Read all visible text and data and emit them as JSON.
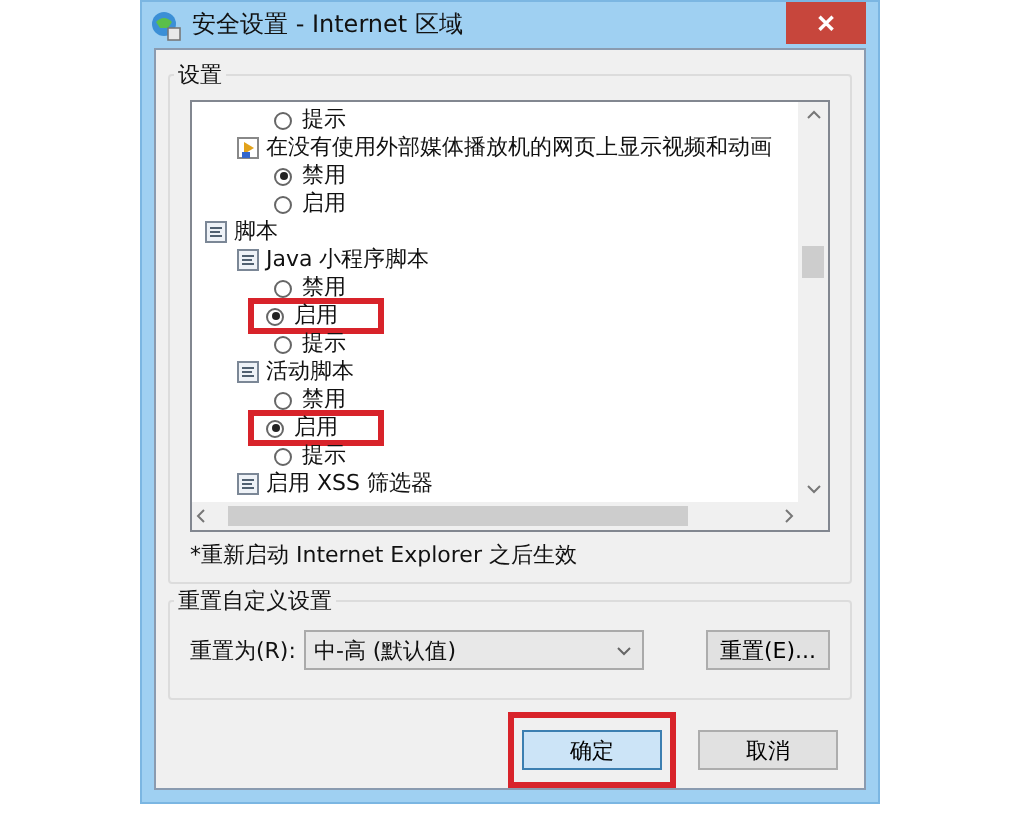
{
  "window": {
    "title": "安全设置 - Internet 区域",
    "close": "✕"
  },
  "settings": {
    "title": "设置",
    "items": [
      {
        "kind": "radio",
        "label": "提示",
        "selected": false,
        "highlighted": false
      },
      {
        "kind": "setting",
        "label": "在没有使用外部媒体播放机的网页上显示视频和动画",
        "children": [
          {
            "kind": "radio",
            "label": "禁用",
            "selected": true,
            "highlighted": false
          },
          {
            "kind": "radio",
            "label": "启用",
            "selected": false,
            "highlighted": false
          }
        ]
      },
      {
        "kind": "category",
        "label": "脚本",
        "children": [
          {
            "kind": "setting",
            "label": "Java 小程序脚本",
            "children": [
              {
                "kind": "radio",
                "label": "禁用",
                "selected": false,
                "highlighted": false
              },
              {
                "kind": "radio",
                "label": "启用",
                "selected": true,
                "highlighted": true
              },
              {
                "kind": "radio",
                "label": "提示",
                "selected": false,
                "highlighted": false
              }
            ]
          },
          {
            "kind": "setting",
            "label": "活动脚本",
            "children": [
              {
                "kind": "radio",
                "label": "禁用",
                "selected": false,
                "highlighted": false
              },
              {
                "kind": "radio",
                "label": "启用",
                "selected": true,
                "highlighted": true
              },
              {
                "kind": "radio",
                "label": "提示",
                "selected": false,
                "highlighted": false
              }
            ]
          },
          {
            "kind": "setting",
            "label": "启用 XSS 筛选器"
          }
        ]
      }
    ],
    "note": "*重新启动 Internet Explorer 之后生效"
  },
  "reset": {
    "title": "重置自定义设置",
    "label": "重置为(R):",
    "value": "中-高 (默认值)",
    "button": "重置(E)..."
  },
  "buttons": [
    {
      "label": "确定",
      "default": true,
      "highlighted": true
    },
    {
      "label": "取消",
      "default": false,
      "highlighted": false
    }
  ]
}
